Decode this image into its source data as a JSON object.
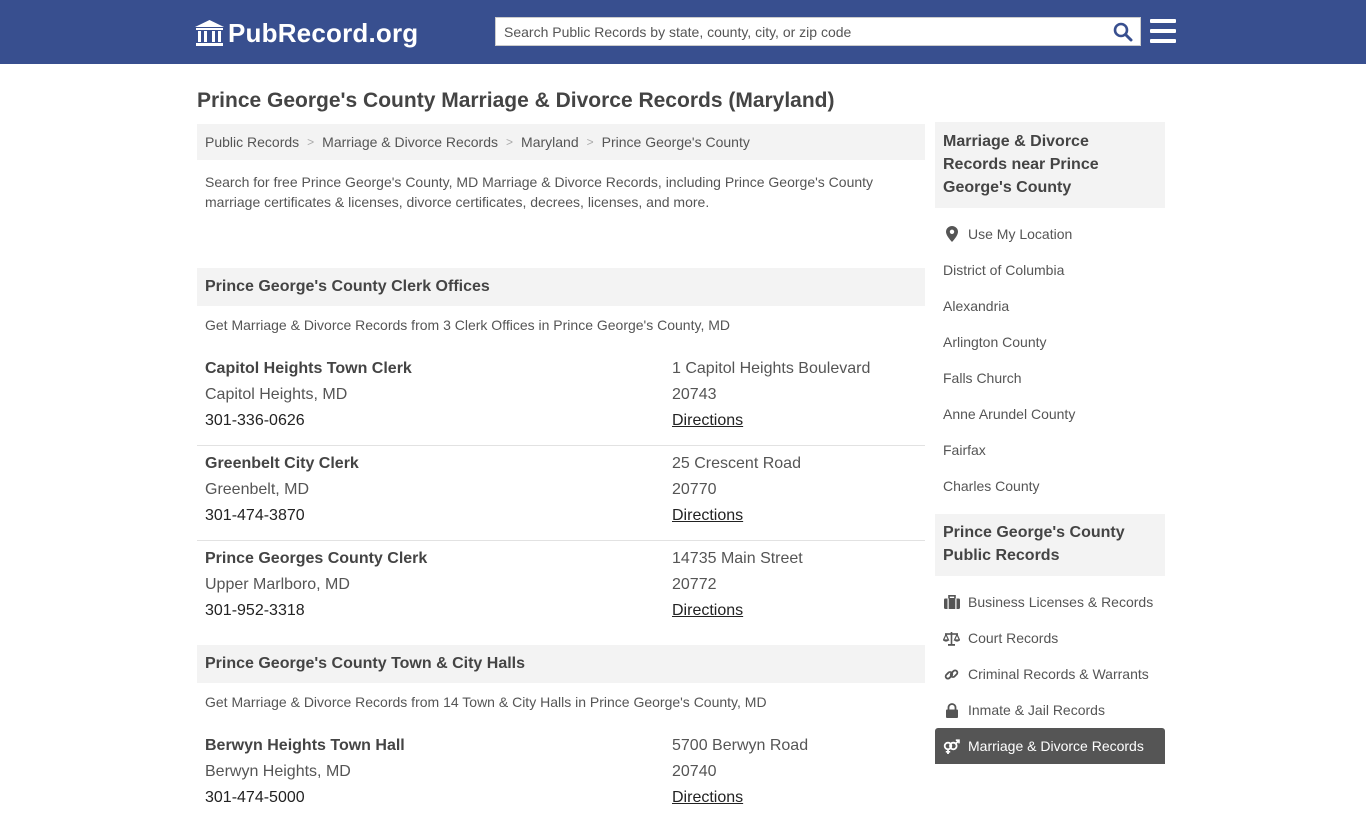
{
  "header": {
    "logo_text": "PubRecord.org",
    "search_placeholder": "Search Public Records by state, county, city, or zip code",
    "search_value": ""
  },
  "page_title": "Prince George's County Marriage & Divorce Records (Maryland)",
  "breadcrumb": [
    "Public Records",
    "Marriage & Divorce Records",
    "Maryland",
    "Prince George's County"
  ],
  "intro": "Search for free Prince George's County, MD Marriage & Divorce Records, including Prince George's County marriage certificates & licenses, divorce certificates, decrees, licenses, and more.",
  "sections": [
    {
      "title": "Prince George's County Clerk Offices",
      "description": "Get Marriage & Divorce Records from 3 Clerk Offices in Prince George's County, MD",
      "offices": [
        {
          "name": "Capitol Heights Town Clerk",
          "city": "Capitol Heights, MD",
          "phone": "301-336-0626",
          "address": "1 Capitol Heights Boulevard",
          "zip": "20743",
          "directions": "Directions"
        },
        {
          "name": "Greenbelt City Clerk",
          "city": "Greenbelt, MD",
          "phone": "301-474-3870",
          "address": "25 Crescent Road",
          "zip": "20770",
          "directions": "Directions"
        },
        {
          "name": "Prince Georges County Clerk",
          "city": "Upper Marlboro, MD",
          "phone": "301-952-3318",
          "address": "14735 Main Street",
          "zip": "20772",
          "directions": "Directions"
        }
      ]
    },
    {
      "title": "Prince George's County Town & City Halls",
      "description": "Get Marriage & Divorce Records from 14 Town & City Halls in Prince George's County, MD",
      "offices": [
        {
          "name": "Berwyn Heights Town Hall",
          "city": "Berwyn Heights, MD",
          "phone": "301-474-5000",
          "address": "5700 Berwyn Road",
          "zip": "20740",
          "directions": "Directions"
        }
      ]
    }
  ],
  "sidebar": {
    "nearby": {
      "title": "Marriage & Divorce Records near Prince George's County",
      "use_location": "Use My Location",
      "items": [
        "District of Columbia",
        "Alexandria",
        "Arlington County",
        "Falls Church",
        "Anne Arundel County",
        "Fairfax",
        "Charles County"
      ]
    },
    "public_records": {
      "title": "Prince George's County Public Records",
      "items": [
        {
          "label": "Business Licenses & Records",
          "icon": "briefcase-icon"
        },
        {
          "label": "Court Records",
          "icon": "scales-icon"
        },
        {
          "label": "Criminal Records & Warrants",
          "icon": "link-icon"
        },
        {
          "label": "Inmate & Jail Records",
          "icon": "lock-icon"
        },
        {
          "label": "Marriage & Divorce Records",
          "icon": "venus-mars-icon",
          "active": true
        }
      ]
    }
  }
}
